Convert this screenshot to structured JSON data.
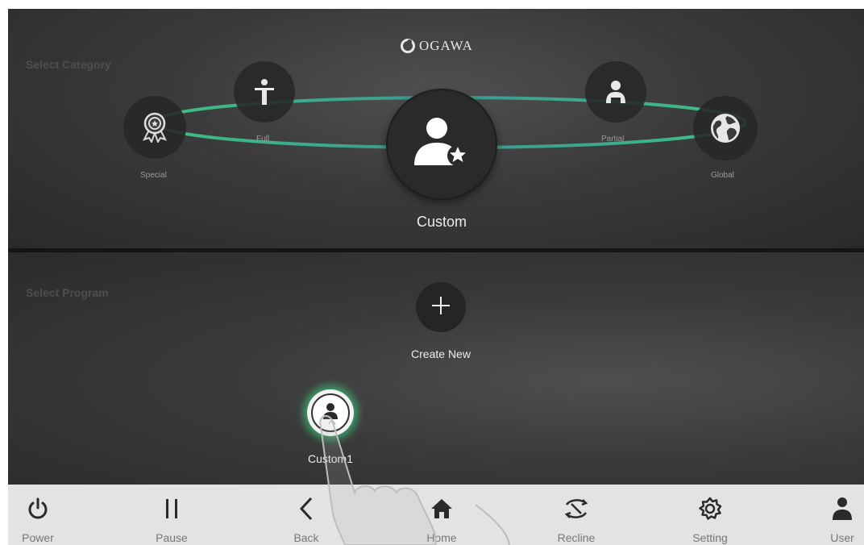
{
  "brand": {
    "name": "OGAWA"
  },
  "category_section": {
    "label": "Select Category",
    "categories": [
      {
        "label": "Special",
        "icon": "award-ribbon-icon"
      },
      {
        "label": "Full",
        "icon": "full-body-icon"
      },
      {
        "label": "Partial",
        "icon": "upper-body-icon"
      },
      {
        "label": "Global",
        "icon": "globe-icon"
      }
    ],
    "selected": {
      "label": "Custom",
      "icon": "user-star-icon"
    }
  },
  "program_section": {
    "label": "Select Program",
    "create_new_label": "Create New",
    "programs": [
      {
        "label": "Custom1",
        "icon": "user-icon"
      }
    ]
  },
  "toolbar": {
    "items": [
      {
        "label": "Power",
        "icon": "power-icon"
      },
      {
        "label": "Pause",
        "icon": "pause-icon"
      },
      {
        "label": "Back",
        "icon": "chevron-left-icon"
      },
      {
        "label": "Home",
        "icon": "home-icon"
      },
      {
        "label": "Recline",
        "icon": "recline-icon"
      },
      {
        "label": "Setting",
        "icon": "gear-icon"
      },
      {
        "label": "User",
        "icon": "user-icon"
      }
    ]
  },
  "colors": {
    "accent_green": "#3fcf8e",
    "accent_teal": "#3a9f9b",
    "panel_dark": "#2f2f2f",
    "toolbar_bg": "#e3e3e3",
    "icon_dark": "#2a2a2a"
  }
}
